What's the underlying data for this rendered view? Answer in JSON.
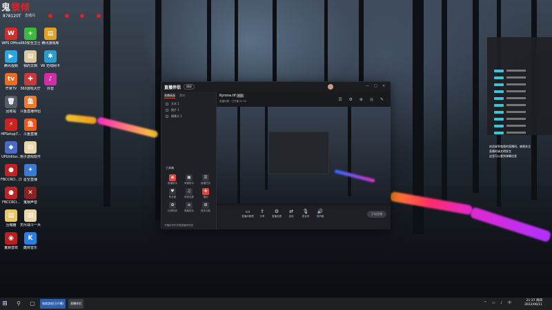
{
  "stream_overlay": {
    "logo_text_a": "鬼",
    "logo_text_b": "锁",
    "logo_text_c": "倾",
    "room_id": "878120T",
    "sub_text": "直播间"
  },
  "desktop_icons": [
    {
      "label": "WPS Office",
      "glyph": "W",
      "color": "#d52b2b"
    },
    {
      "label": "360安全卫士",
      "glyph": "+",
      "color": "#3fb83f"
    },
    {
      "label": "腾讯游戏库",
      "glyph": "▤",
      "color": "#e0a12a"
    },
    {
      "label": "腾讯视频",
      "glyph": "▶",
      "color": "#2aa6e0"
    },
    {
      "label": "我的文档",
      "glyph": "▤",
      "color": "#d8c9a0"
    },
    {
      "label": "Wi 无线网卡",
      "glyph": "✱",
      "color": "#2b9ccc"
    },
    {
      "label": "芒果TV",
      "glyph": "tv",
      "color": "#ef6a1c"
    },
    {
      "label": "360游戏大厅",
      "glyph": "✚",
      "color": "#c93b3b"
    },
    {
      "label": "抖音",
      "glyph": "♪",
      "color": "#d02ea8"
    },
    {
      "label": "回收站",
      "glyph": "🗑",
      "color": "#555d66"
    },
    {
      "label": "斗鱼直播伴侣",
      "glyph": "鱼",
      "color": "#f07a2a"
    },
    {
      "label": "HPSetup7...",
      "glyph": "⚡",
      "color": "#c22"
    },
    {
      "label": "斗鱼直播",
      "glyph": "鱼",
      "color": "#e85a1a"
    },
    {
      "label": "UPUtilitor...",
      "glyph": "◆",
      "color": "#4a6ac8"
    },
    {
      "label": "电子游戏软件汇总",
      "glyph": "▤",
      "color": "#e6d6a8"
    },
    {
      "label": "FBCCRCl...(1)",
      "glyph": "●",
      "color": "#c02323"
    },
    {
      "label": "星空直播",
      "glyph": "✦",
      "color": "#3a7bd5"
    },
    {
      "label": "FBCCRCl...",
      "glyph": "●",
      "color": "#c02323"
    },
    {
      "label": "鬼锁声音",
      "glyph": "✕",
      "color": "#8b2222"
    },
    {
      "label": "压缩器",
      "glyph": "▤",
      "color": "#e6c86a"
    },
    {
      "label": "无尽战斗一大...",
      "glyph": "▤",
      "color": "#e6d6a8"
    },
    {
      "label": "鬼锁音效",
      "glyph": "◉",
      "color": "#b82020"
    },
    {
      "label": "酷狗音乐",
      "glyph": "K",
      "color": "#2a7fe0"
    }
  ],
  "app": {
    "logo": "直播伴侣",
    "mode_pill": "横屏",
    "window_controls": [
      "—",
      "□",
      "✕"
    ],
    "left_tabs": [
      "直播画面",
      "素材"
    ],
    "sources": [
      "文本 1",
      "图片 1",
      "摄像头 1"
    ],
    "toolbox_title": "工具箱",
    "tools": [
      {
        "label": "直播助手",
        "glyph": "◉",
        "hot": true
      },
      {
        "label": "房管助手",
        "glyph": "▣",
        "hot": false
      },
      {
        "label": "直播任务",
        "glyph": "☰",
        "hot": false
      },
      {
        "label": "粉丝团",
        "glyph": "♥",
        "hot": false
      },
      {
        "label": "语音连麦",
        "glyph": "♫",
        "hot": false
      },
      {
        "label": "福利",
        "glyph": "✚",
        "hot": true
      },
      {
        "label": "礼物特效",
        "glyph": "✿",
        "hot": false
      },
      {
        "label": "弹幕助手",
        "glyph": "≡",
        "hot": false
      },
      {
        "label": "更多功能",
        "glyph": "⊞",
        "hot": false
      }
    ],
    "footer_text": "开播前请先完善直播间信息",
    "preview_title": "Kyrona.tif",
    "preview_badge": "画面",
    "preview_meta": "直播标题 · 已开播 00:00",
    "preview_icons": "☰ ⚙ ⊕ ◎ ✎",
    "bottom_controls": [
      {
        "label": "直播间管理",
        "glyph": "▭"
      },
      {
        "label": "分享",
        "glyph": "⇪"
      },
      {
        "label": "直播设置",
        "glyph": "⚙"
      },
      {
        "label": "连线",
        "glyph": "⇄"
      },
      {
        "label": "麦克风",
        "glyph": "🎙"
      },
      {
        "label": "扬声器",
        "glyph": "🔊"
      }
    ],
    "start_button": "开始直播"
  },
  "chat_panel": {
    "rows": 10,
    "side_text_1": "欢迎来到鬼锁的直播间，感谢关注",
    "side_text_2": "直播时请文明发言",
    "side_text_3": "这里可以看到弹幕信息"
  },
  "taskbar": {
    "start_glyph": "⊞",
    "search_glyph": "⚲",
    "app_1": "鬼锁游戏(已开播)",
    "app_2": "直播伴侣",
    "tray": "^ ▭ ♪ 中",
    "time": "21:37 周四",
    "date": "2022/06/11"
  }
}
